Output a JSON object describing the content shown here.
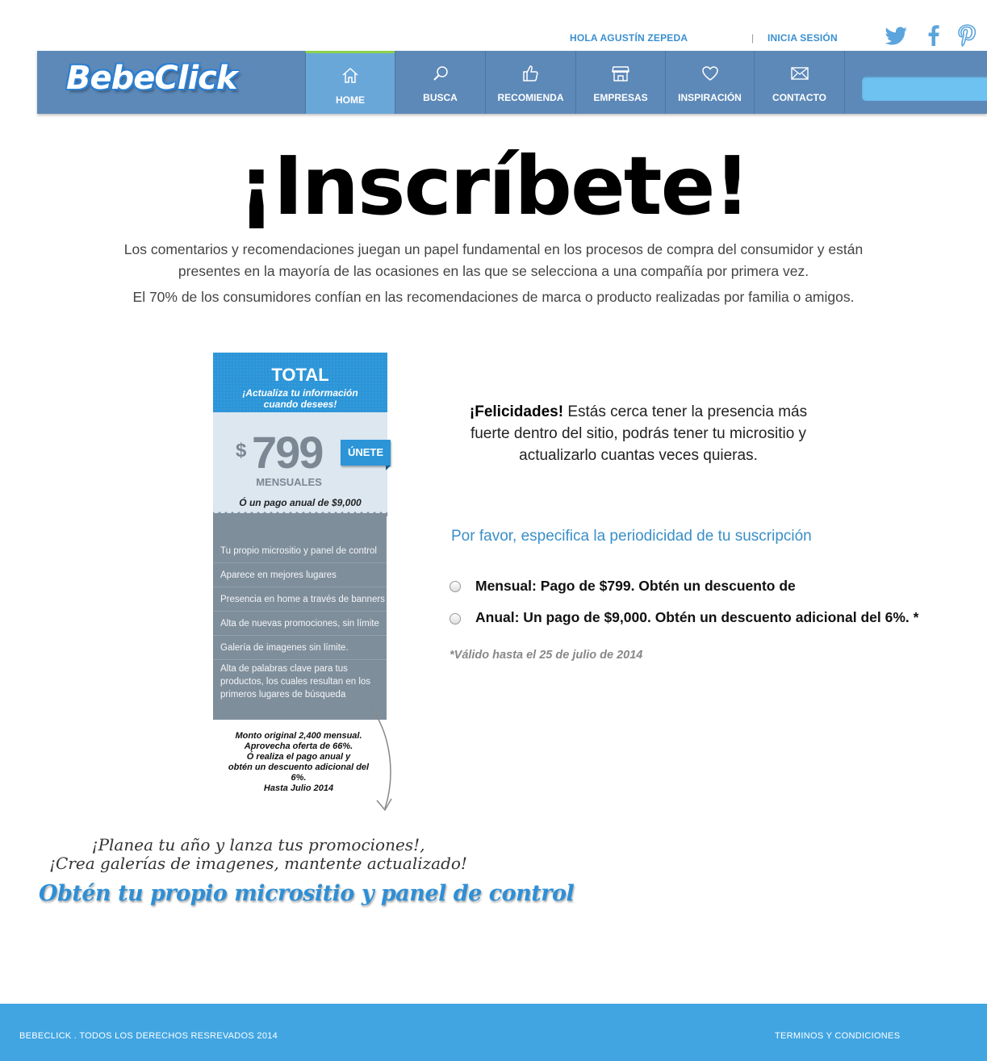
{
  "topbar": {
    "greeting": "HOLA AGUSTÍN ZEPEDA",
    "separator": "|",
    "login": "INICIA SESIÓN",
    "social": [
      {
        "icon": "twitter-icon"
      },
      {
        "icon": "facebook-icon"
      },
      {
        "icon": "pinterest-icon"
      }
    ]
  },
  "nav": {
    "logo": "BebeClick",
    "items": [
      {
        "label": "HOME",
        "icon": "home-icon"
      },
      {
        "label": "BUSCA",
        "icon": "search-icon"
      },
      {
        "label": "RECOMIENDA",
        "icon": "thumbs-up-icon"
      },
      {
        "label": "EMPRESAS",
        "icon": "store-icon"
      },
      {
        "label": "INSPIRACIÓN",
        "icon": "heart-icon"
      },
      {
        "label": "CONTACTO",
        "icon": "envelope-icon"
      }
    ],
    "search_placeholder": ""
  },
  "main": {
    "headline": "¡Inscríbete!",
    "intro": "Los comentarios y recomendaciones juegan un papel fundamental en los procesos de compra del consumidor y están presentes en la mayoría  de las ocasiones en las que se selecciona a una compañía  por primera vez.",
    "intro2": "El 70% de los consumidores confían en las recomendaciones de marca o producto realizadas por familia o amigos."
  },
  "plan": {
    "title": "TOTAL",
    "subtitle_line1": "¡Actualiza tu información",
    "subtitle_line2": "cuando desees!",
    "currency": "$",
    "price": "799",
    "period": "MENSUALES",
    "annual": "Ó un pago anual de $9,000",
    "join_label": "ÚNETE",
    "features": [
      "Tu propio micrositio y panel de control",
      "Aparece en mejores lugares",
      "Presencia en home a través de banners",
      "Alta de nuevas promociones, sin límite",
      "Galería de imagenes sin límite.",
      "Alta de palabras clave para tus productos, los cuales resultan en los primeros lugares de búsqueda"
    ],
    "note": [
      "Monto original 2,400 mensual.",
      "Aprovecha oferta de 66%.",
      "Ó realiza el pago anual y",
      "obtén un descuento adicional del",
      "6%.",
      "Hasta Julio 2014"
    ]
  },
  "promo": {
    "line1": "¡Planea tu año y lanza tus promociones!,",
    "line2": "¡Crea galerías de imagenes, mantente actualizado!",
    "line3": "Obtén tu propio micrositio y panel de control"
  },
  "subscription": {
    "congrats_bold": "¡Felicidades!",
    "congrats_text": " Estás cerca tener la presencia más fuerte dentro del sitio, podrás tener tu micrositio y actualizarlo cuantas veces quieras.",
    "question": "Por favor, especifica la periodicidad de tu suscripción",
    "options": [
      {
        "label": "Mensual: Pago de $799. Obtén un descuento de"
      },
      {
        "label": "Anual: Un pago de $9,000. Obtén un descuento adicional del 6%. *"
      }
    ],
    "validity": "*Válido hasta el 25 de julio de 2014"
  },
  "footer": {
    "copyright": "BEBECLICK . TODOS LOS DERECHOS RESREVADOS 2014",
    "terms": "TERMINOS Y CONDICIONES"
  }
}
